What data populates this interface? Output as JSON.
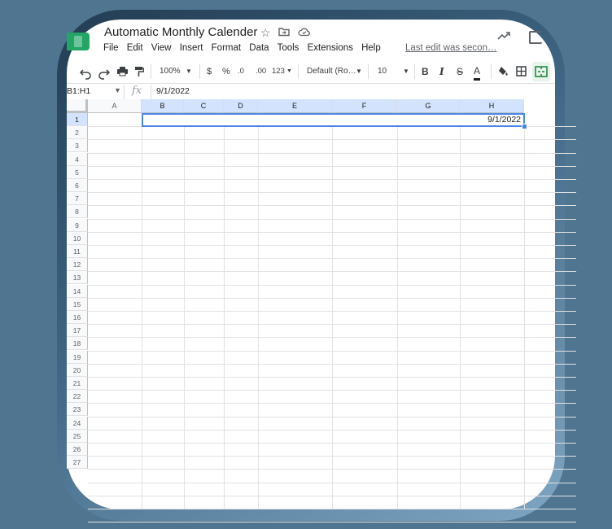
{
  "app": {
    "title": "Automatic Monthly Calender",
    "menu": [
      "File",
      "Edit",
      "View",
      "Insert",
      "Format",
      "Data",
      "Tools",
      "Extensions",
      "Help"
    ],
    "last_edit": "Last edit was secon…"
  },
  "toolbar": {
    "zoom": "100%",
    "currency": "$",
    "percent": "%",
    "dec_decrease": ".0",
    "dec_increase": ".00",
    "more_formats": "123",
    "font": "Default (Ro…",
    "font_size": "10",
    "bold": "B",
    "italic": "I",
    "strike": "S",
    "text_color": "A"
  },
  "formula_bar": {
    "name_box": "B1:H1",
    "fx": "fx",
    "value": "9/1/2022"
  },
  "sheet": {
    "columns": [
      "A",
      "B",
      "C",
      "D",
      "E",
      "F",
      "G",
      "H"
    ],
    "rows": [
      "1",
      "2",
      "3",
      "4",
      "5",
      "6",
      "7",
      "8",
      "9",
      "10",
      "11",
      "12",
      "13",
      "14",
      "15",
      "16",
      "17",
      "18",
      "19",
      "20",
      "21",
      "22",
      "23",
      "24",
      "25",
      "26",
      "27"
    ],
    "selected_range": "B1:H1",
    "merged_value": "9/1/2022"
  },
  "colors": {
    "background": "#4f7591",
    "selection": "#4a86e8",
    "selected_header": "#d3e3fd",
    "sheets_green": "#23a566"
  }
}
